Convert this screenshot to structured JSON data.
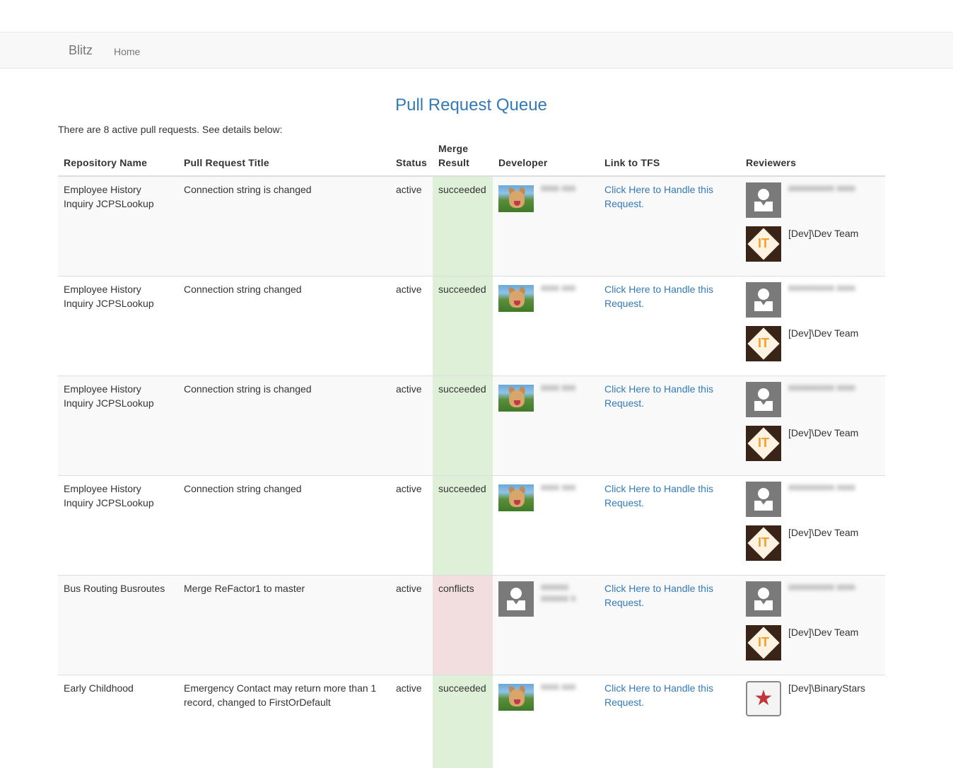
{
  "nav": {
    "brand": "Blitz",
    "home": "Home"
  },
  "page": {
    "title": "Pull Request Queue",
    "summary": "There are 8 active pull requests. See details below:"
  },
  "table": {
    "headers": {
      "repo": "Repository Name",
      "title": "Pull Request Title",
      "status": "Status",
      "merge": "Merge Result",
      "developer": "Developer",
      "link": "Link to TFS",
      "reviewers": "Reviewers"
    },
    "rows": [
      {
        "repo": "Employee History Inquiry JCPSLookup",
        "title": "Connection string is changed",
        "status": "active",
        "merge": "succeeded",
        "link": "Click Here to Handle this Request.",
        "reviewer2": "[Dev]\\Dev Team"
      },
      {
        "repo": "Employee History Inquiry JCPSLookup",
        "title": "Connection string changed",
        "status": "active",
        "merge": "succeeded",
        "link": "Click Here to Handle this Request.",
        "reviewer2": "[Dev]\\Dev Team"
      },
      {
        "repo": "Employee History Inquiry JCPSLookup",
        "title": "Connection string is changed",
        "status": "active",
        "merge": "succeeded",
        "link": "Click Here to Handle this Request.",
        "reviewer2": "[Dev]\\Dev Team"
      },
      {
        "repo": "Employee History Inquiry JCPSLookup",
        "title": "Connection string changed",
        "status": "active",
        "merge": "succeeded",
        "link": "Click Here to Handle this Request.",
        "reviewer2": "[Dev]\\Dev Team"
      },
      {
        "repo": "Bus Routing Busroutes",
        "title": "Merge ReFactor1 to master",
        "status": "active",
        "merge": "conflicts",
        "link": "Click Here to Handle this Request.",
        "reviewer2": "[Dev]\\Dev Team"
      },
      {
        "repo": "Early Childhood",
        "title": "Emergency Contact may return more than 1 record, changed to FirstOrDefault",
        "status": "active",
        "merge": "succeeded",
        "link": "Click Here to Handle this Request.",
        "reviewer1": "[Dev]\\BinaryStars"
      }
    ]
  },
  "colors": {
    "succeeded": "#dff0d8",
    "conflicts": "#f2dede",
    "link": "#337ab7"
  }
}
